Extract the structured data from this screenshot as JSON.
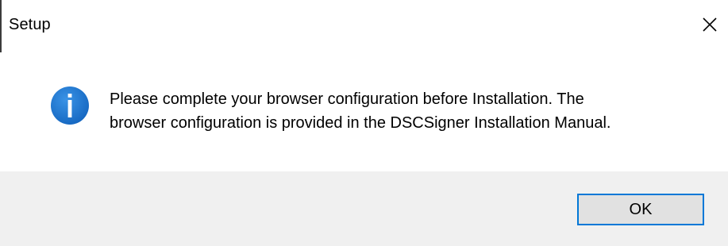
{
  "window": {
    "title": "Setup",
    "close_icon": "close-icon"
  },
  "message": {
    "icon": "info-icon",
    "icon_color": "#1a73c8",
    "line1": "Please complete your browser configuration before Installation. The",
    "line2": "browser configuration is provided in the DSCSigner Installation Manual."
  },
  "buttons": {
    "ok_label": "OK",
    "ok_border_color": "#0078d7"
  },
  "colors": {
    "button_bar": "#f0f0f0",
    "content_bg": "#ffffff"
  }
}
